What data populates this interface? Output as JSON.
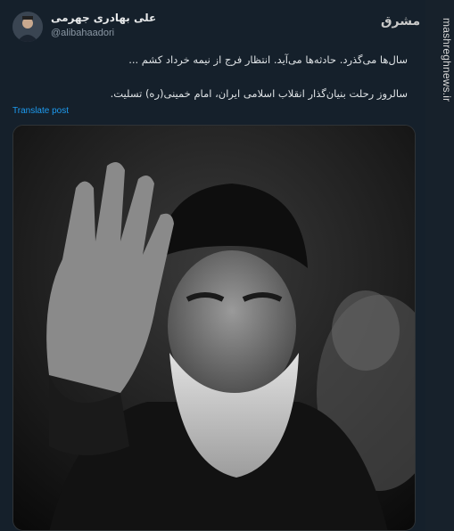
{
  "author": {
    "display_name": "علی بهادری جهرمی",
    "handle": "@alibahaadori"
  },
  "post": {
    "line1": "سال‌ها می‌گذرد. حادثه‌ها می‌آید. انتظار فرج از نیمه خرداد کشم ...",
    "line2": "سالروز رحلت بنیان‌گذار انقلاب اسلامی ایران، امام خمینی(ره) تسلیت."
  },
  "translate_label": "Translate post",
  "watermark": {
    "logo": "مشرق",
    "url": "mashreghnews.ir"
  },
  "colors": {
    "background": "#15202b",
    "link": "#1d9bf0",
    "text": "#dfe3e6",
    "muted": "#8b98a5"
  }
}
